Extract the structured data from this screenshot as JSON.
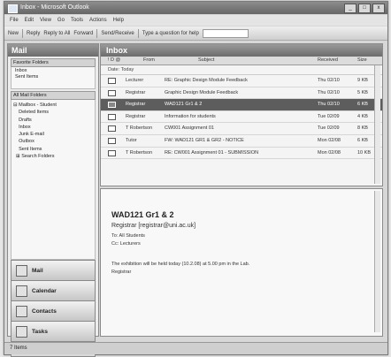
{
  "window": {
    "title": "Inbox - Microsoft Outlook",
    "buttons": [
      "_",
      "□",
      "x"
    ]
  },
  "menubar": [
    "File",
    "Edit",
    "View",
    "Go",
    "Tools",
    "Actions",
    "Help"
  ],
  "toolbar": {
    "new_label": "New",
    "reply_label": "Reply",
    "reply_all_label": "Reply to All",
    "forward_label": "Forward",
    "send_receive_label": "Send/Receive",
    "search_label": "Type a question for help"
  },
  "nav": {
    "header": "Mail",
    "favorites_header": "Favorite Folders",
    "favorites": [
      "Inbox",
      "Sent Items"
    ],
    "all_folders_header": "All Mail Folders",
    "folders": [
      "Mailbox - Student",
      "Deleted Items",
      "Drafts",
      "Inbox",
      "Junk E-mail",
      "Outbox",
      "Sent Items",
      "Search Folders"
    ],
    "buttons": [
      "Mail",
      "Calendar",
      "Contacts",
      "Tasks"
    ]
  },
  "inbox": {
    "title": "Inbox",
    "columns": [
      "! D @",
      "From",
      "Subject",
      "Received",
      "Size"
    ],
    "group_label": "Date: Today",
    "rows": [
      {
        "from": "Lecturer",
        "subject": "RE: Graphic Design Module Feedback",
        "received": "Thu 02/10",
        "size": "9 KB"
      },
      {
        "from": "Registrar",
        "subject": "Graphic Design Module Feedback",
        "received": "Thu 02/10",
        "size": "5 KB"
      },
      {
        "from": "Registrar",
        "subject": "WAD121 Gr1 & 2",
        "received": "Thu 02/10",
        "size": "6 KB"
      },
      {
        "from": "Registrar",
        "subject": "Information for students",
        "received": "Tue 02/09",
        "size": "4 KB"
      },
      {
        "from": "T Robertson",
        "subject": "CW001 Assignment 01",
        "received": "Tue 02/09",
        "size": "8 KB"
      },
      {
        "from": "Tutor",
        "subject": "FW: WAD121 GR1 & GR2 - NOTICE",
        "received": "Mon 02/08",
        "size": "6 KB"
      },
      {
        "from": "T Robertson",
        "subject": "RE: CW001 Assignment 01 - SUBMISSION",
        "received": "Mon 02/08",
        "size": "10 KB"
      }
    ]
  },
  "reading": {
    "subject": "WAD121 Gr1 & 2",
    "from": "Registrar [registrar@uni.ac.uk]",
    "to_line": "To: All Students",
    "cc_line": "Cc: Lecturers",
    "body": "The exhibition will be held today (10.2.08) at 5.00 pm in the Lab.",
    "signature": "Registrar"
  },
  "status": {
    "text": "7 Items"
  }
}
